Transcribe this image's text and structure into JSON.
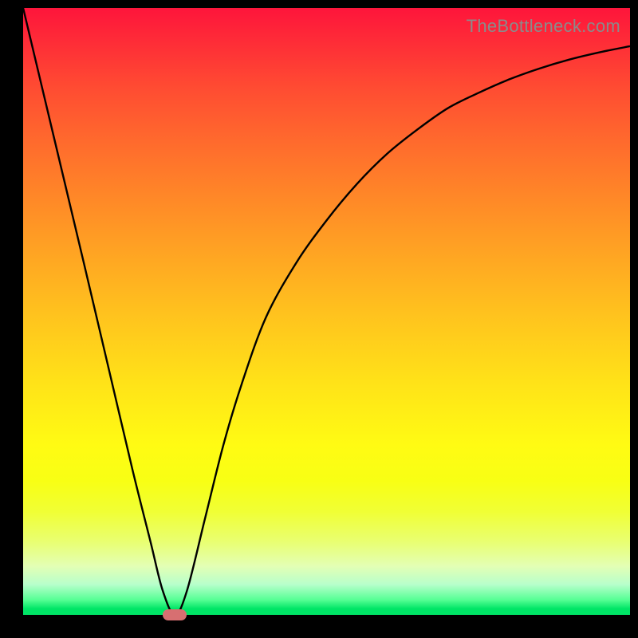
{
  "watermark": "TheBottleneck.com",
  "colors": {
    "frame": "#000000",
    "curve": "#000000",
    "marker": "#d76f71"
  },
  "chart_data": {
    "type": "line",
    "title": "",
    "xlabel": "",
    "ylabel": "",
    "xlim": [
      0,
      100
    ],
    "ylim": [
      0,
      100
    ],
    "grid": false,
    "legend": false,
    "background_gradient": [
      "#fe153b",
      "#ff8a27",
      "#fffb13",
      "#00e566"
    ],
    "series": [
      {
        "name": "bottleneck-curve",
        "x": [
          0,
          5,
          10,
          14,
          18,
          21,
          23,
          25,
          27,
          30,
          33,
          36,
          40,
          45,
          50,
          55,
          60,
          65,
          70,
          75,
          80,
          85,
          90,
          95,
          100
        ],
        "values": [
          100,
          79,
          58,
          41,
          24,
          12,
          4,
          0,
          4,
          16,
          28,
          38,
          49,
          58,
          65,
          71,
          76,
          80,
          83.5,
          86,
          88.2,
          90,
          91.5,
          92.7,
          93.7
        ]
      }
    ],
    "marker": {
      "x": 25,
      "y": 0
    }
  }
}
